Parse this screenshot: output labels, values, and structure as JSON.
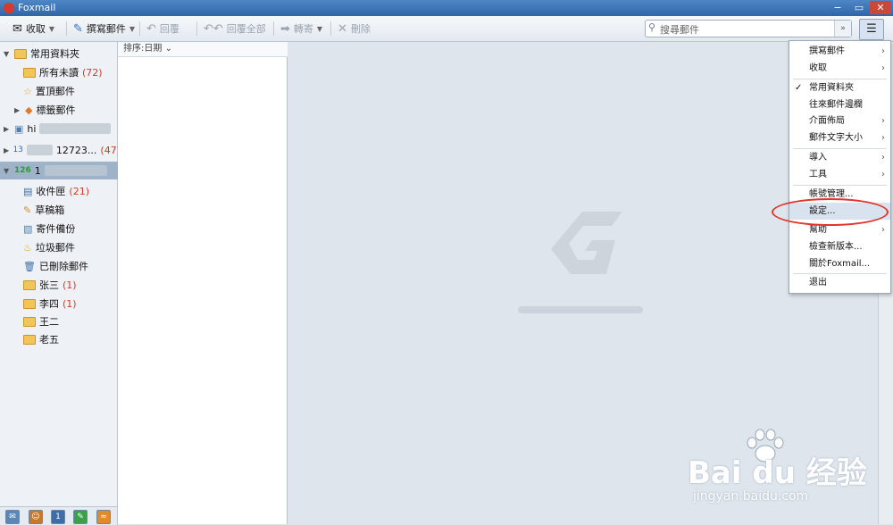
{
  "window": {
    "title": "Foxmail",
    "controls": [
      "−",
      "▭",
      "✕"
    ]
  },
  "toolbar": {
    "receive": "收取",
    "compose": "撰寫郵件",
    "reply": "回覆",
    "reply_all": "回覆全部",
    "forward": "轉寄",
    "delete": "刪除"
  },
  "search": {
    "placeholder": "搜尋郵件"
  },
  "sidebar": {
    "common_folder": "常用資料夾",
    "unread": "所有未讀",
    "unread_count": "(72)",
    "pinned": "置頂郵件",
    "tagged": "標籤郵件",
    "account1_label": "hi",
    "account2_prefix": "13",
    "account2_label": "12723...",
    "account2_count": "(47)",
    "account3_prefix": "126",
    "account3_label": "1",
    "inbox": "收件匣",
    "inbox_count": "(21)",
    "drafts": "草稿箱",
    "sent": "寄件備份",
    "junk": "垃圾郵件",
    "deleted": "已刪除郵件",
    "folder_zhang": "张三",
    "folder_zhang_count": "(1)",
    "folder_li": "李四",
    "folder_li_count": "(1)",
    "folder_wang": "王二",
    "folder_lao": "老五"
  },
  "list": {
    "sort_label": "排序:日期"
  },
  "menu": {
    "items": [
      "撰寫郵件",
      "收取",
      "常用資料夾",
      "往來郵件邊欄",
      "介面佈局",
      "郵件文字大小",
      "導入",
      "工具",
      "帳號管理...",
      "設定...",
      "幫助",
      "檢查新版本...",
      "關於Foxmail...",
      "退出"
    ]
  },
  "watermark": {
    "brand": "Bai du 经验",
    "url": "jingyan.baidu.com"
  }
}
